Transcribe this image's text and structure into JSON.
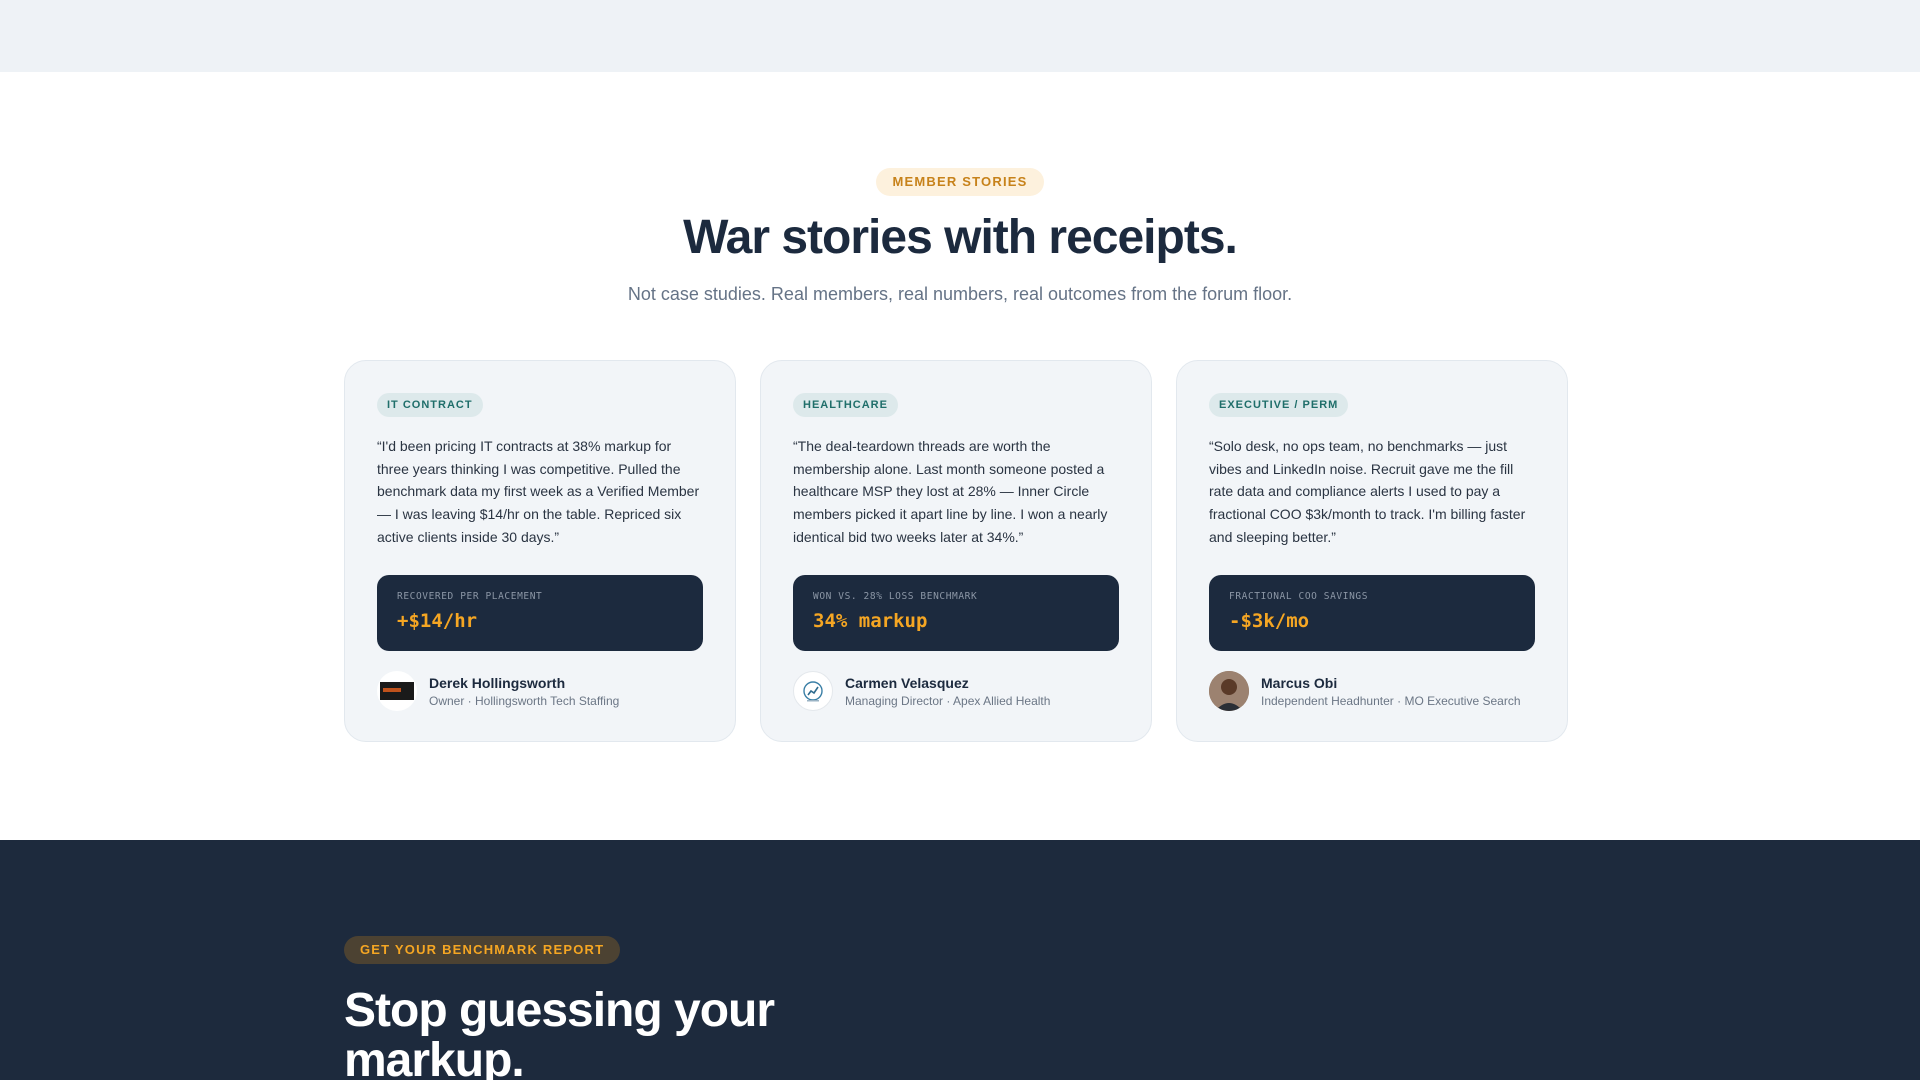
{
  "colors": {
    "accent_orange": "#f5a623",
    "navy": "#1c2a3e",
    "tag_teal": "#1f6e6a",
    "card_bg": "#f2f5f8"
  },
  "stories_section": {
    "eyebrow": "MEMBER STORIES",
    "title": "War stories with receipts.",
    "subtitle": "Not case studies. Real members, real numbers, real outcomes from the forum floor."
  },
  "cards": [
    {
      "tag": "IT CONTRACT",
      "quote": "“I'd been pricing IT contracts at 38% markup for three years thinking I was competitive. Pulled the benchmark data my first week as a Verified Member — I was leaving $14/hr on the table. Repriced six active clients inside 30 days.”",
      "stat_label": "RECOVERED PER PLACEMENT",
      "stat_value": "+$14/hr",
      "name": "Derek Hollingsworth",
      "role": "Owner · Hollingsworth Tech Staffing",
      "avatar": "company-logo-dark"
    },
    {
      "tag": "HEALTHCARE",
      "quote": "“The deal-teardown threads are worth the membership alone. Last month someone posted a healthcare MSP they lost at 28% — Inner Circle members picked it apart line by line. I won a nearly identical bid two weeks later at 34%.”",
      "stat_label": "WON VS. 28% LOSS BENCHMARK",
      "stat_value": "34% markup",
      "name": "Carmen Velasquez",
      "role": "Managing Director · Apex Allied Health",
      "avatar": "company-logo-light"
    },
    {
      "tag": "EXECUTIVE / PERM",
      "quote": "“Solo desk, no ops team, no benchmarks — just vibes and LinkedIn noise. Recruit gave me the fill rate data and compliance alerts I used to pay a fractional COO $3k/month to track. I'm billing faster and sleeping better.”",
      "stat_label": "FRACTIONAL COO SAVINGS",
      "stat_value": "-$3k/mo",
      "name": "Marcus Obi",
      "role": "Independent Headhunter · MO Executive Search",
      "avatar": "person-photo"
    }
  ],
  "cta_section": {
    "pill": "GET YOUR BENCHMARK REPORT",
    "title": "Stop guessing your markup."
  }
}
